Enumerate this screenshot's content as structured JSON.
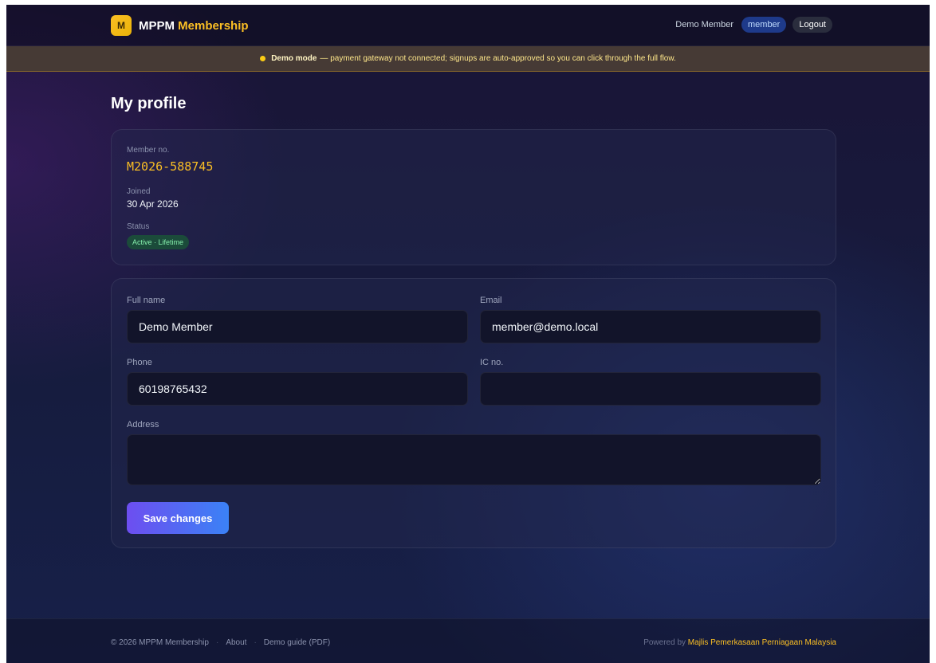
{
  "header": {
    "logo_letter": "M",
    "brand_prefix": "MPPM",
    "brand_accent": "Membership",
    "user_name": "Demo Member",
    "role_badge": "member",
    "logout_label": "Logout"
  },
  "banner": {
    "title": "Demo mode",
    "message": "— payment gateway not connected; signups are auto-approved so you can click through the full flow."
  },
  "page": {
    "title": "My profile"
  },
  "info": {
    "member_no_label": "Member no.",
    "member_no": "M2026-588745",
    "joined_label": "Joined",
    "joined": "30 Apr 2026",
    "status_label": "Status",
    "status": "Active · Lifetime"
  },
  "form": {
    "full_name_label": "Full name",
    "full_name": "Demo Member",
    "email_label": "Email",
    "email": "member@demo.local",
    "phone_label": "Phone",
    "phone": "60198765432",
    "ic_label": "IC no.",
    "ic": "",
    "address_label": "Address",
    "address": "",
    "save_label": "Save changes"
  },
  "footer": {
    "copyright": "© 2026 MPPM Membership",
    "sep": "·",
    "about": "About",
    "demo_guide": "Demo guide (PDF)",
    "powered_prefix": "Powered by",
    "powered_link": "Majlis Pemerkasaan Perniagaan Malaysia"
  },
  "colors": {
    "accent_gold": "#fbbf24",
    "primary_gradient_start": "#6d4ef0",
    "primary_gradient_end": "#3b82f6",
    "status_green": "#86efac"
  }
}
